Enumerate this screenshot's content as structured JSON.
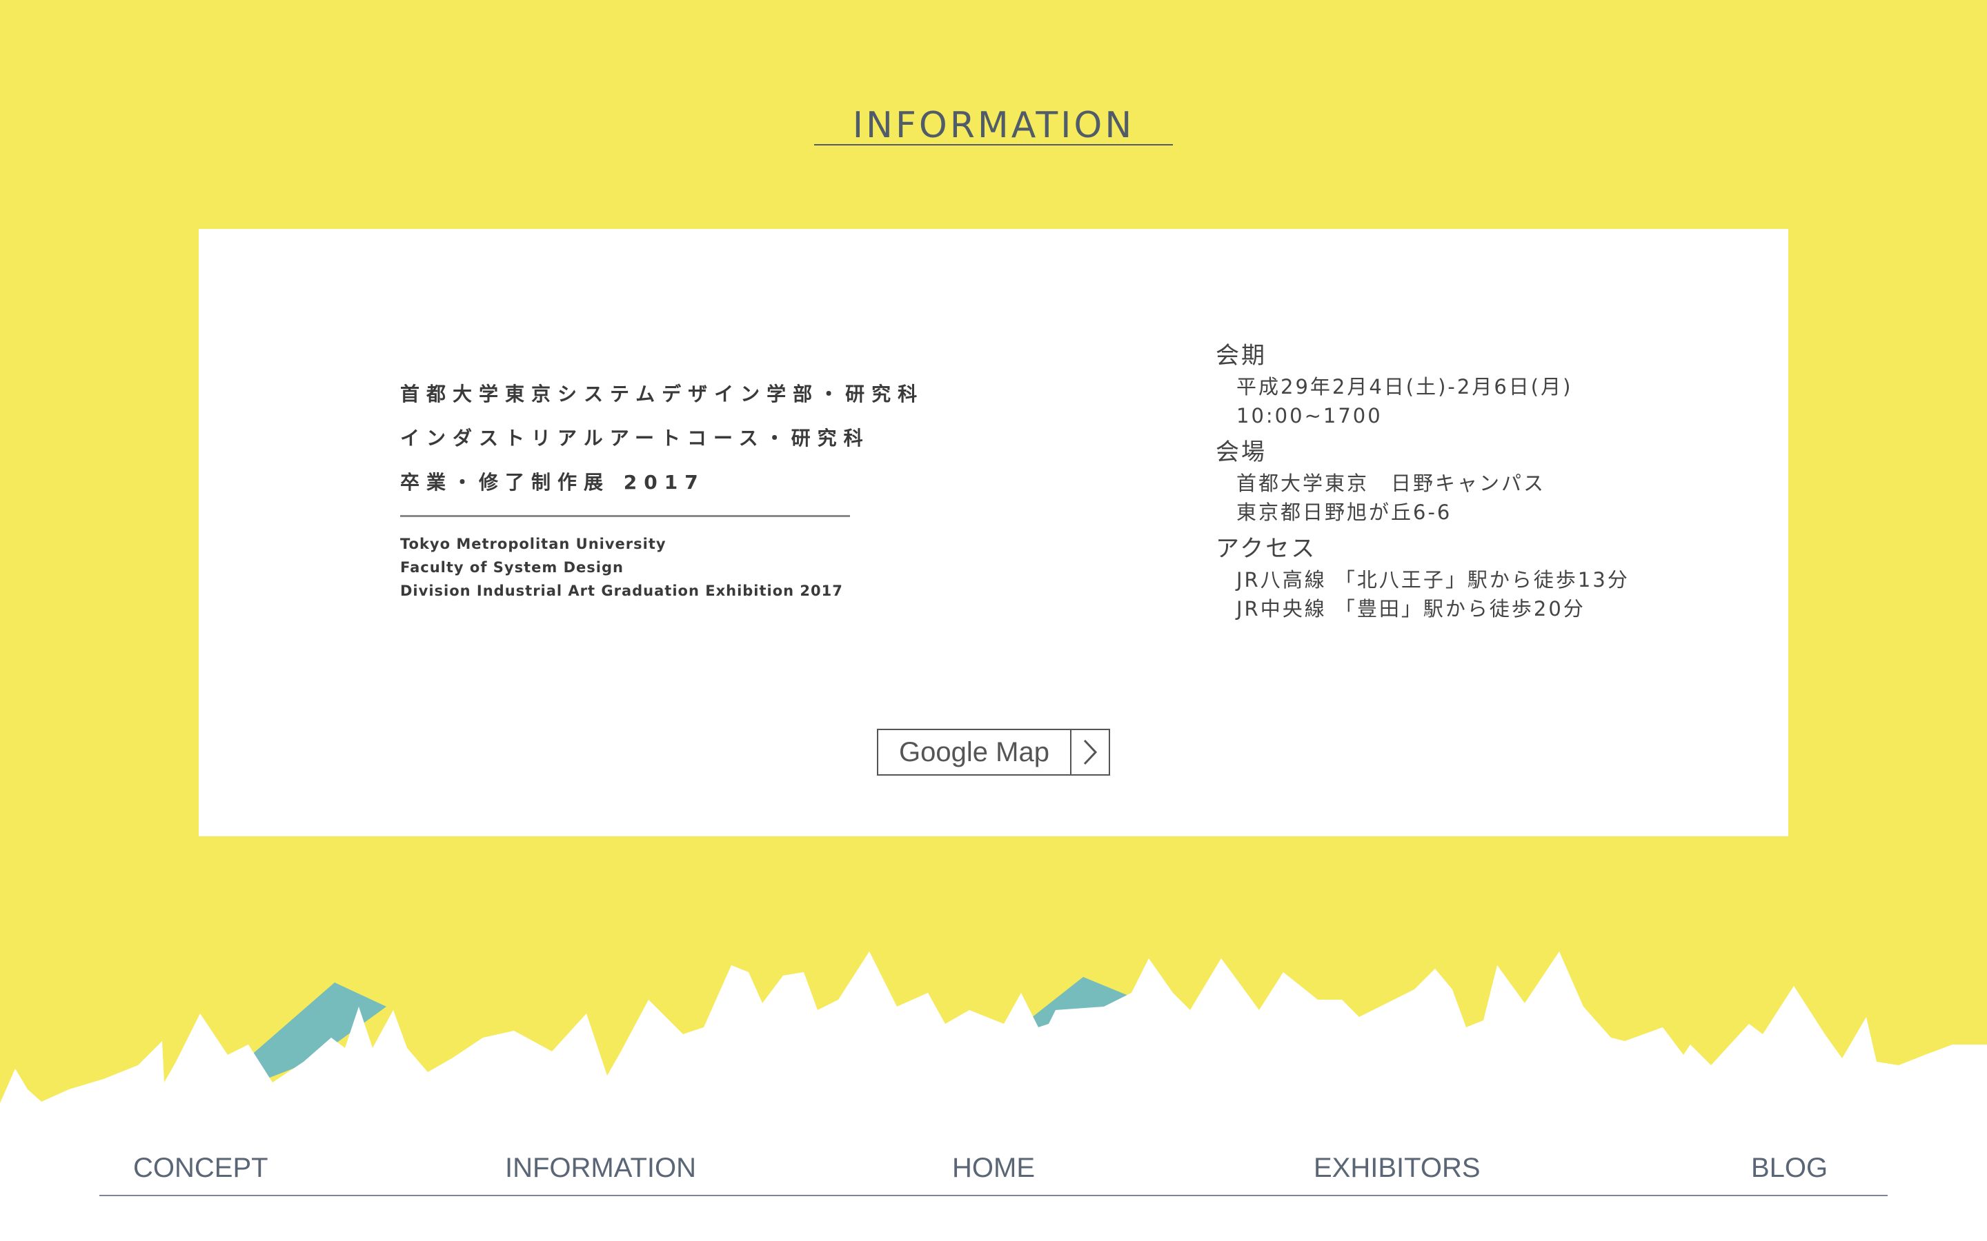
{
  "colors": {
    "background_yellow": "#f4ea5b",
    "accent_teal": "#76bcbd",
    "text": "#4c5563"
  },
  "section": {
    "title": "INFORMATION"
  },
  "exhibition": {
    "title_jp": [
      "首都大学東京システムデザイン学部・研究科",
      "インダストリアルアートコース・研究科",
      "卒業・修了制作展 2017"
    ],
    "title_en": [
      "Tokyo Metropolitan University",
      "Faculty of System Design",
      "Division Industrial Art Graduation Exhibition 2017"
    ]
  },
  "info": {
    "period": {
      "heading": "会期",
      "lines": [
        "平成29年2月4日(土)-2月6日(月)",
        "10:00~1700"
      ]
    },
    "venue": {
      "heading": "会場",
      "lines": [
        "首都大学東京　日野キャンパス",
        "東京都日野旭が丘6-6"
      ]
    },
    "access": {
      "heading": "アクセス",
      "lines": [
        "JR八高線 「北八王子」駅から徒歩13分",
        "JR中央線 「豊田」駅から徒歩20分"
      ]
    }
  },
  "map_button": {
    "label": "Google Map",
    "icon": "chevron-right-icon"
  },
  "footer_nav": {
    "items": [
      {
        "label": "CONCEPT"
      },
      {
        "label": "INFORMATION"
      },
      {
        "label": "HOME"
      },
      {
        "label": "EXHIBITORS"
      },
      {
        "label": "BLOG"
      }
    ]
  }
}
